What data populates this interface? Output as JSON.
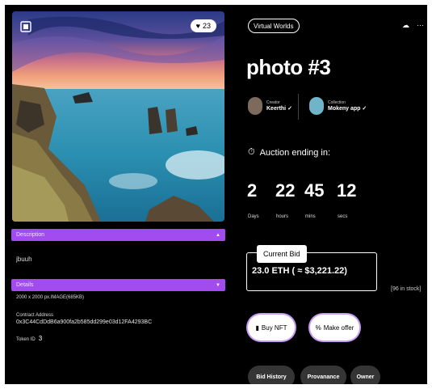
{
  "nft": {
    "likes": "23",
    "title": "photo #3"
  },
  "description": {
    "header": "Description",
    "text": "jbuuh"
  },
  "details": {
    "header": "Details",
    "dimensions": "2000 x 2000 px.IMAGE(685KB)",
    "contract_label": "Contract Address",
    "contract_address": "0x3C44CdDdB6a900fa2b585dd299e03d12FA4293BC",
    "token_label": "Token ID",
    "token_id": "3"
  },
  "header": {
    "tag": "Virtual Worlds"
  },
  "creator": {
    "label": "Creator",
    "name": "Keerthi"
  },
  "collection": {
    "label": "Collection",
    "name": "Mokeny app"
  },
  "auction": {
    "label": "Auction ending in:",
    "days": "2",
    "hours": "22",
    "mins": "45",
    "secs": "12",
    "days_label": "Days",
    "hours_label": "hours",
    "mins_label": "mins",
    "secs_label": "secs"
  },
  "bid": {
    "label": "Current Bid",
    "value": "23.0 ETH  ( ≈ $3,221.22)",
    "stock": "[96 in stock]"
  },
  "actions": {
    "buy": "Buy NFT",
    "offer": "Make offer"
  },
  "tabs": [
    "Bid History",
    "Provanance",
    "Owner"
  ],
  "colors": {
    "background": "#000000",
    "accent": "#a24cf0",
    "button": "#ffffff",
    "tab": "#353535"
  }
}
